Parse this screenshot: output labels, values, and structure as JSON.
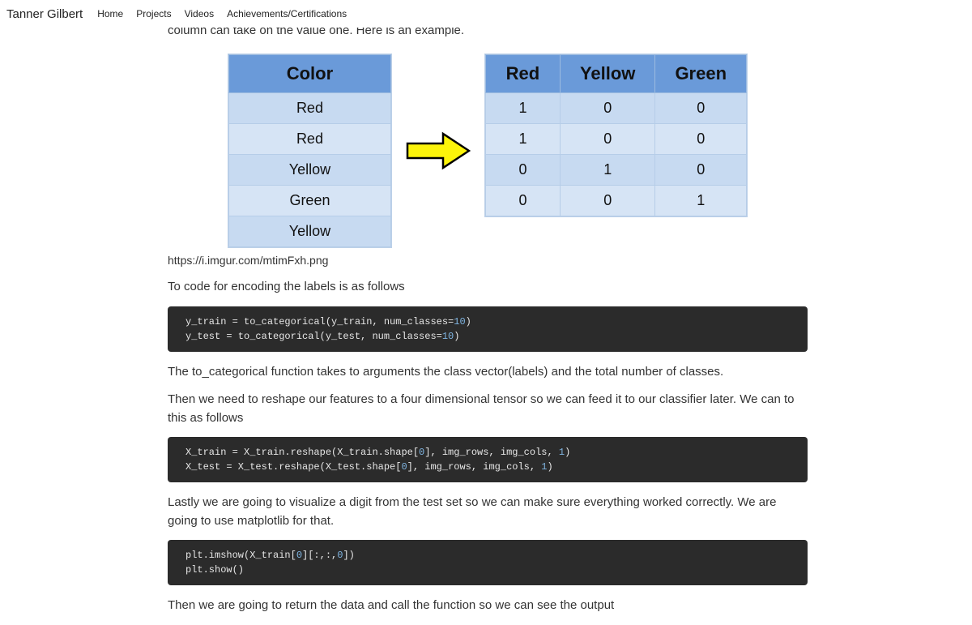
{
  "header": {
    "brand": "Tanner Gilbert",
    "nav": [
      "Home",
      "Projects",
      "Videos",
      "Achievements/Certifications"
    ]
  },
  "paragraphs": {
    "p1": "works better with classification and regression algorithms. It generates a boolean column for each category. Only one column can take on the value one. Here is an example.",
    "caption": "https://i.imgur.com/mtimFxh.png",
    "p2": "To code for encoding the labels is as follows",
    "p3": "The to_categorical function takes to arguments the class vector(labels) and the total number of classes.",
    "p4": "Then we need to reshape our features to a four dimensional tensor so we can feed it to our classifier later. We can to this as follows",
    "p5": "Lastly we are going to visualize a digit from the test set so we can make sure everything worked correctly. We are going to use matplotlib for that.",
    "p6": "Then we are going to return the data and call the function so we can see the output"
  },
  "figure": {
    "left": {
      "header": "Color",
      "rows": [
        "Red",
        "Red",
        "Yellow",
        "Green",
        "Yellow"
      ]
    },
    "right": {
      "headers": [
        "Red",
        "Yellow",
        "Green"
      ],
      "rows": [
        [
          "1",
          "0",
          "0"
        ],
        [
          "1",
          "0",
          "0"
        ],
        [
          "0",
          "1",
          "0"
        ],
        [
          "0",
          "0",
          "1"
        ]
      ]
    }
  },
  "code": {
    "c1": "y_train = to_categorical(y_train, num_classes=10)\ny_test = to_categorical(y_test, num_classes=10)",
    "c2": "X_train = X_train.reshape(X_train.shape[0], img_rows, img_cols, 1)\nX_test = X_test.reshape(X_test.shape[0], img_rows, img_cols, 1)",
    "c3": "plt.imshow(X_train[0][:,:,0])\nplt.show()"
  }
}
